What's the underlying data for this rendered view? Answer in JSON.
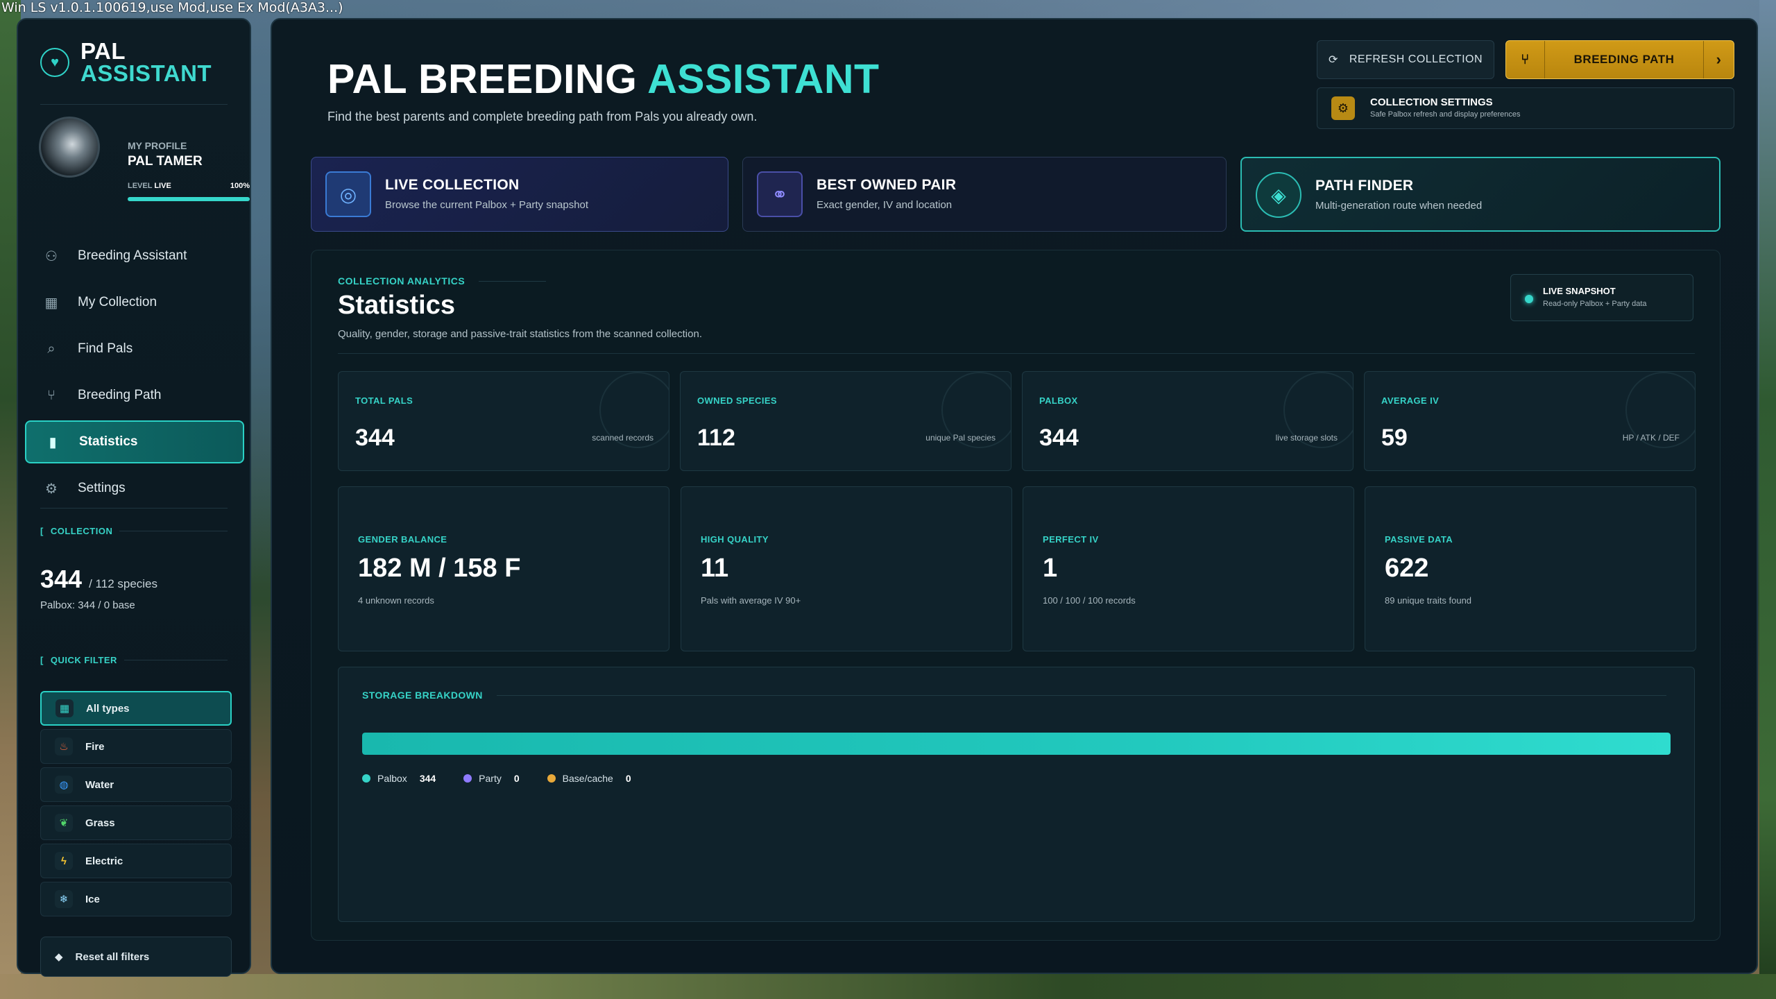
{
  "window": {
    "title": "Win LS v1.0.1.100619,use Mod,use Ex Mod(A3A3...)"
  },
  "sidebar": {
    "logo": {
      "line1": "PAL",
      "line2": "ASSISTANT"
    },
    "profile": {
      "label": "MY PROFILE",
      "name": "PAL TAMER",
      "level_label": "LEVEL",
      "level_value": "LIVE",
      "progress_text": "100%",
      "progress": 1.0
    },
    "nav": [
      {
        "label": "Breeding Assistant",
        "icon": "breeding-icon"
      },
      {
        "label": "My Collection",
        "icon": "grid-icon"
      },
      {
        "label": "Find Pals",
        "icon": "search-icon"
      },
      {
        "label": "Breeding Path",
        "icon": "branch-icon"
      },
      {
        "label": "Statistics",
        "icon": "chart-icon",
        "active": true
      },
      {
        "label": "Settings",
        "icon": "gear-icon"
      }
    ],
    "collection": {
      "label": "COLLECTION",
      "count": "344",
      "species": "/ 112 species",
      "palbox": "Palbox: 344 / 0 base"
    },
    "quick_filter": {
      "label": "QUICK FILTER",
      "items": [
        {
          "label": "All types",
          "icon": "all-types-icon",
          "color": "#36d3c7",
          "active": true
        },
        {
          "label": "Fire",
          "icon": "fire-icon",
          "color": "#ff6a3d"
        },
        {
          "label": "Water",
          "icon": "water-icon",
          "color": "#3a9bff"
        },
        {
          "label": "Grass",
          "icon": "leaf-icon",
          "color": "#52d46a"
        },
        {
          "label": "Electric",
          "icon": "bolt-icon",
          "color": "#f5c431"
        },
        {
          "label": "Ice",
          "icon": "snowflake-icon",
          "color": "#8fd9ff"
        }
      ]
    },
    "reset_label": "Reset all filters"
  },
  "header": {
    "title_main": "PAL BREEDING",
    "title_accent": "ASSISTANT",
    "subtitle": "Find the best parents and complete breeding path from Pals you already own.",
    "refresh_label": "REFRESH COLLECTION",
    "breeding_path_label": "BREEDING PATH",
    "settings_card": {
      "title": "COLLECTION SETTINGS",
      "subtitle": "Safe Palbox refresh and display preferences"
    }
  },
  "modes": [
    {
      "title": "LIVE COLLECTION",
      "subtitle": "Browse the current Palbox + Party snapshot",
      "icon": "collection-icon"
    },
    {
      "title": "BEST OWNED PAIR",
      "subtitle": "Exact gender, IV and location",
      "icon": "pair-icon"
    },
    {
      "title": "PATH FINDER",
      "subtitle": "Multi-generation route when needed",
      "icon": "diamond-icon"
    }
  ],
  "statistics": {
    "section_label": "COLLECTION ANALYTICS",
    "title": "Statistics",
    "subtitle": "Quality, gender, storage and passive-trait statistics from the scanned collection.",
    "live_snapshot": {
      "title": "LIVE SNAPSHOT",
      "subtitle": "Read-only Palbox + Party data"
    },
    "top_cards": [
      {
        "label": "TOTAL PALS",
        "value": "344",
        "note": "scanned records"
      },
      {
        "label": "OWNED SPECIES",
        "value": "112",
        "note": "unique Pal species"
      },
      {
        "label": "PALBOX",
        "value": "344",
        "note": "live storage slots"
      },
      {
        "label": "AVERAGE IV",
        "value": "59",
        "note": "HP / ATK / DEF"
      }
    ],
    "detail_cards": [
      {
        "label": "GENDER BALANCE",
        "value": "182 M / 158 F",
        "note": "4 unknown records"
      },
      {
        "label": "HIGH QUALITY",
        "value": "11",
        "note": "Pals with average IV 90+"
      },
      {
        "label": "PERFECT IV",
        "value": "1",
        "note": "100 / 100 / 100 records"
      },
      {
        "label": "PASSIVE DATA",
        "value": "622",
        "note": "89 unique traits found"
      }
    ],
    "storage": {
      "label": "STORAGE BREAKDOWN",
      "segments": [
        {
          "name": "Palbox",
          "value": 344,
          "display": "344",
          "color": "#36d3c7"
        },
        {
          "name": "Party",
          "value": 0,
          "display": "0",
          "color": "#8f7bff"
        },
        {
          "name": "Base/cache",
          "value": 0,
          "display": "0",
          "color": "#e8a93a"
        }
      ]
    }
  }
}
